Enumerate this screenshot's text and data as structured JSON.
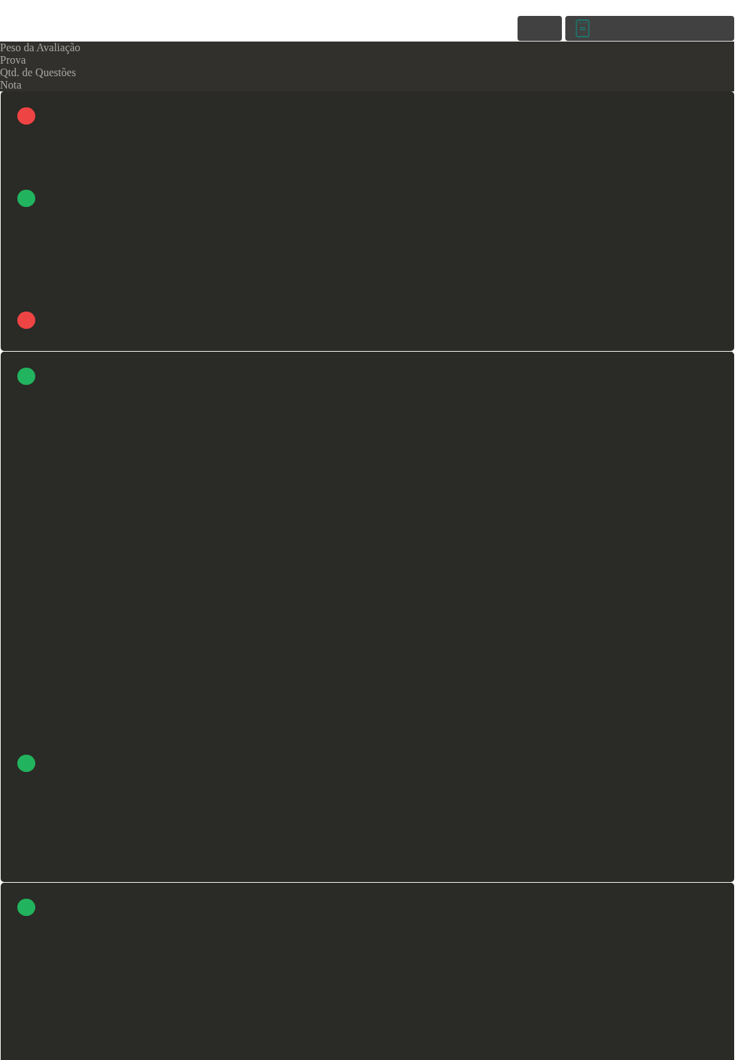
{
  "toolbar": {
    "buttons": [
      {
        "kind": "plain"
      },
      {
        "kind": "notes"
      }
    ]
  },
  "header_labels": [
    "Peso da Avaliação",
    "Prova",
    "Qtd. de Questões",
    "Nota"
  ],
  "cards": [
    {
      "dots": [
        {
          "color": "#ef4444"
        },
        {
          "color": "#22b35e"
        },
        {
          "color": "#ef4444"
        }
      ]
    },
    {
      "dots": [
        {
          "color": "#22b35e"
        },
        {
          "color": "#22b35e"
        }
      ]
    },
    {
      "dots": [
        {
          "color": "#22b35e"
        }
      ]
    }
  ]
}
